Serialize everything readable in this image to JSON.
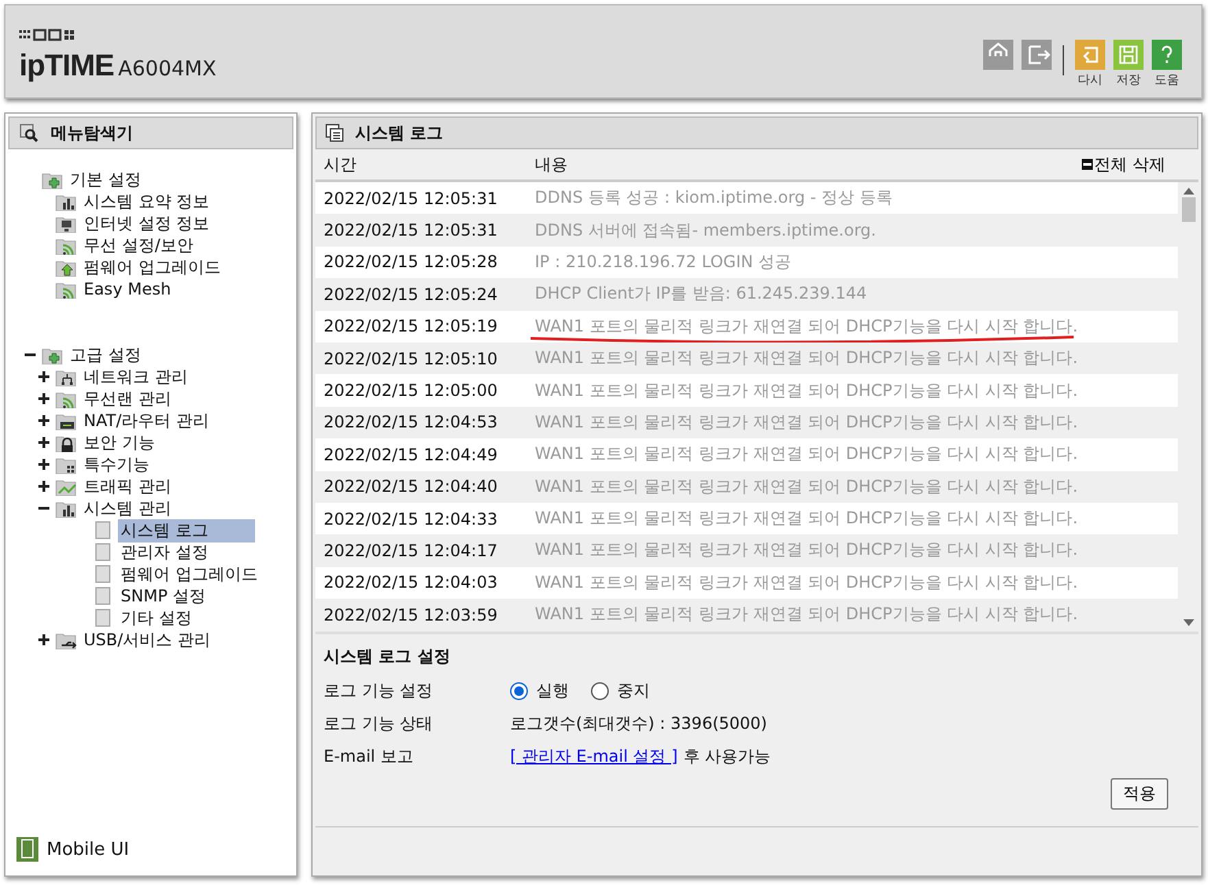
{
  "header": {
    "brand": "ipTIME",
    "model": "A6004MX",
    "buttons": [
      {
        "kind": "home"
      },
      {
        "kind": "logout"
      },
      {
        "kind": "undo",
        "label": "다시"
      },
      {
        "kind": "save",
        "label": "저장"
      },
      {
        "kind": "help",
        "label": "도움"
      }
    ]
  },
  "sidebar": {
    "title": "메뉴탐색기",
    "footer": "Mobile UI",
    "tree": [
      {
        "label": "기본 설정",
        "kind": "folder-plus",
        "children": [
          {
            "label": "시스템 요약 정보",
            "kind": "chart",
            "selected": false
          },
          {
            "label": "인터넷 설정 정보",
            "kind": "monitor",
            "selected": false
          },
          {
            "label": "무선 설정/보안",
            "kind": "wifi",
            "selected": false
          },
          {
            "label": "펌웨어 업그레이드",
            "kind": "upload",
            "selected": false
          },
          {
            "label": "Easy Mesh",
            "kind": "wifi",
            "selected": false
          }
        ]
      },
      {
        "label": "고급 설정",
        "kind": "folder-plus",
        "expanded": true,
        "children": [
          {
            "label": "네트워크 관리",
            "kind": "network",
            "expanded": false,
            "selected": false
          },
          {
            "label": "무선랜 관리",
            "kind": "wifi",
            "expanded": false,
            "selected": false
          },
          {
            "label": "NAT/라우터 관리",
            "kind": "router",
            "expanded": false,
            "selected": false
          },
          {
            "label": "보안 기능",
            "kind": "lock",
            "expanded": false,
            "selected": false
          },
          {
            "label": "특수기능",
            "kind": "grid",
            "expanded": false,
            "selected": false
          },
          {
            "label": "트래픽 관리",
            "kind": "traffic",
            "expanded": false,
            "selected": false
          },
          {
            "label": "시스템 관리",
            "kind": "chart",
            "expanded": true,
            "selected": false,
            "children": [
              {
                "label": "시스템 로그",
                "kind": "blank",
                "selected": true
              },
              {
                "label": "관리자 설정",
                "kind": "blank",
                "selected": false
              },
              {
                "label": "펌웨어 업그레이드",
                "kind": "blank",
                "selected": false
              },
              {
                "label": "SNMP 설정",
                "kind": "blank",
                "selected": false
              },
              {
                "label": "기타 설정",
                "kind": "blank",
                "selected": false
              }
            ]
          },
          {
            "label": "USB/서비스 관리",
            "kind": "usb",
            "expanded": false,
            "selected": false
          }
        ]
      }
    ]
  },
  "main": {
    "title": "시스템 로그",
    "table": {
      "columns": [
        "시간",
        "내용"
      ],
      "clear_all": "전체 삭제",
      "rows": [
        {
          "time": "2022/02/15 12:05:31",
          "message": "DDNS 등록 성공 : kiom.iptime.org - 정상 등록",
          "underlined": false
        },
        {
          "time": "2022/02/15 12:05:31",
          "message": "DDNS 서버에 접속됨- members.iptime.org.",
          "underlined": false
        },
        {
          "time": "2022/02/15 12:05:28",
          "message": "IP : 210.218.196.72 LOGIN 성공",
          "underlined": false
        },
        {
          "time": "2022/02/15 12:05:24",
          "message": "DHCP Client가 IP를 받음: 61.245.239.144",
          "underlined": false
        },
        {
          "time": "2022/02/15 12:05:19",
          "message": "WAN1 포트의 물리적 링크가 재연결 되어 DHCP기능을 다시 시작 합니다.",
          "underlined": true
        },
        {
          "time": "2022/02/15 12:05:10",
          "message": "WAN1 포트의 물리적 링크가 재연결 되어 DHCP기능을 다시 시작 합니다.",
          "underlined": false
        },
        {
          "time": "2022/02/15 12:05:00",
          "message": "WAN1 포트의 물리적 링크가 재연결 되어 DHCP기능을 다시 시작 합니다.",
          "underlined": false
        },
        {
          "time": "2022/02/15 12:04:53",
          "message": "WAN1 포트의 물리적 링크가 재연결 되어 DHCP기능을 다시 시작 합니다.",
          "underlined": false
        },
        {
          "time": "2022/02/15 12:04:49",
          "message": "WAN1 포트의 물리적 링크가 재연결 되어 DHCP기능을 다시 시작 합니다.",
          "underlined": false
        },
        {
          "time": "2022/02/15 12:04:40",
          "message": "WAN1 포트의 물리적 링크가 재연결 되어 DHCP기능을 다시 시작 합니다.",
          "underlined": false
        },
        {
          "time": "2022/02/15 12:04:33",
          "message": "WAN1 포트의 물리적 링크가 재연결 되어 DHCP기능을 다시 시작 합니다.",
          "underlined": false
        },
        {
          "time": "2022/02/15 12:04:17",
          "message": "WAN1 포트의 물리적 링크가 재연결 되어 DHCP기능을 다시 시작 합니다.",
          "underlined": false
        },
        {
          "time": "2022/02/15 12:04:03",
          "message": "WAN1 포트의 물리적 링크가 재연결 되어 DHCP기능을 다시 시작 합니다.",
          "underlined": false
        },
        {
          "time": "2022/02/15 12:03:59",
          "message": "WAN1 포트의 물리적 링크가 재연결 되어 DHCP기능을 다시 시작 합니다.",
          "underlined": false
        }
      ]
    },
    "settings": {
      "title": "시스템 로그 설정",
      "rows": [
        {
          "kind": "radio",
          "label": "로그 기능 설정",
          "options": [
            {
              "label": "실행",
              "selected": true
            },
            {
              "label": "중지",
              "selected": false
            }
          ]
        },
        {
          "kind": "text",
          "label": "로그 기능 상태",
          "value": "로그갯수(최대갯수) : 3396(5000)"
        },
        {
          "kind": "link",
          "label": "E-mail 보고",
          "link": "[ 관리자 E-mail 설정 ]",
          "value": "후 사용가능"
        }
      ],
      "apply": "적용"
    }
  }
}
